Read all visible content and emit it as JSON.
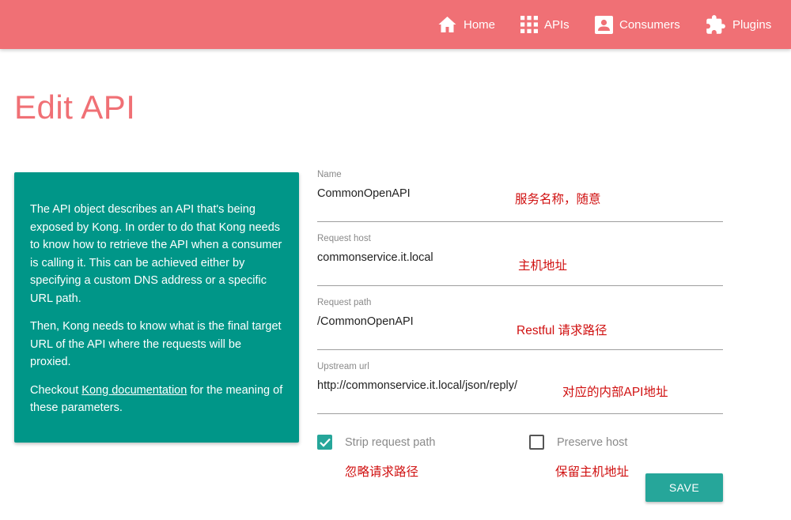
{
  "nav": {
    "home": "Home",
    "apis": "APIs",
    "consumers": "Consumers",
    "plugins": "Plugins"
  },
  "page": {
    "title": "Edit API"
  },
  "info": {
    "p1": "The API object describes an API that's being exposed by Kong. In order to do that Kong needs to know how to retrieve the API when a consumer is calling it. This can be achieved either by specifying a custom DNS address or a specific URL path.",
    "p2": "Then, Kong needs to know what is the final target URL of the API where the requests will be proxied.",
    "p3_before": "Checkout ",
    "p3_link": "Kong documentation",
    "p3_after": " for the meaning of these parameters."
  },
  "form": {
    "name": {
      "label": "Name",
      "value": "CommonOpenAPI"
    },
    "request_host": {
      "label": "Request host",
      "value": "commonservice.it.local"
    },
    "request_path": {
      "label": "Request path",
      "value": "/CommonOpenAPI"
    },
    "upstream_url": {
      "label": "Upstream url",
      "value": "http://commonservice.it.local/json/reply/"
    },
    "strip_request_path": {
      "label": "Strip request path",
      "checked": true
    },
    "preserve_host": {
      "label": "Preserve host",
      "checked": false
    },
    "save_label": "SAVE"
  },
  "annotations": {
    "name": "服务名称，随意",
    "host": "主机地址",
    "path": "Restful 请求路径",
    "upstream": "对应的内部API地址",
    "strip": "忽略请求路径",
    "preserve": "保留主机地址"
  },
  "colors": {
    "header": "#f07075",
    "title": "#f07075",
    "info_card": "#009688",
    "accent": "#26a69a",
    "annotation": "#d01010"
  }
}
